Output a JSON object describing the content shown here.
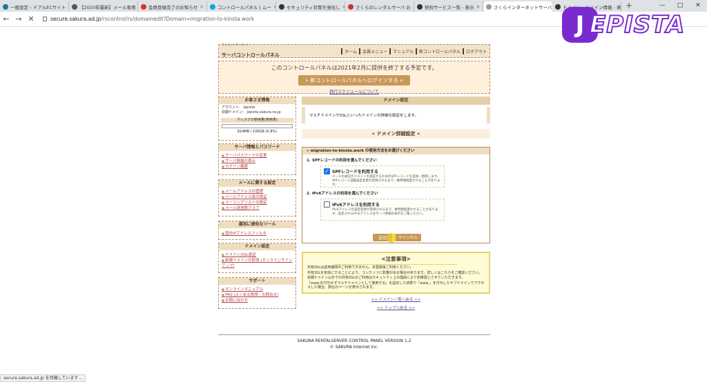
{
  "tabs": [
    "一般設定 ‹ ドアルECサイト",
    "【2020年最新】メール専用",
    "会員登録完了のお知らせ",
    "コントロールパネル | ムー",
    "セキュリティ対策を強化し",
    "さくらのレンタルサーバ お",
    "契約サービス一覧 - 表示",
    "さくらインターネットサーバコ",
    "ドメイン・ドメイン情報 - 表示"
  ],
  "window_controls": [
    "—",
    "□",
    "✕"
  ],
  "address": {
    "host": "secure.sakura.ad.jp",
    "path": "/rscontrol/rs/domainedit?Domain=migration-to-kinsta.work"
  },
  "logo": {
    "j": "J",
    "text": "EPISTA"
  },
  "header": {
    "brand_sub": "さくらインターネット",
    "brand_main": "サーバコントロールパネル",
    "nav": [
      "ホーム",
      "会員メニュー",
      "マニュアル",
      "新コントロールパネル",
      "ログアウト"
    ]
  },
  "notice": {
    "text": "このコントロールパネルは2021年2月に提供を終了する予定です。",
    "button": "» 新コントロールパネルへログインする «",
    "link": "移行スケジュールについて"
  },
  "sidebar": {
    "customer": {
      "title": "お客さま情報",
      "account": "アカウント:　jepista",
      "domain": "初期ドメイン:　jepista.sakura.ne.jp",
      "disk_title": "ディスクの使用量(使用率)",
      "disk_value": "814MB / 100GB (0.8%)"
    },
    "sections": [
      {
        "title": "サーバ情報とパスワード",
        "items": [
          "サーバパスワードの変更",
          "サーバ情報の表示",
          "ログイン履歴"
        ]
      },
      {
        "title": "メールに関する設定",
        "items": [
          "メールアドレスの管理",
          "メールアドレス毎の設定",
          "メーリングリストの設定",
          "メール送信数グラフ"
        ]
      },
      {
        "title": "運用に便利なツール",
        "items": [
          "国外IPアドレスフィルタ"
        ]
      },
      {
        "title": "ドメイン設定",
        "items": [
          "ドメイン/SSL設定",
          "新規ドメインの取得 (オンラインサインアップ)"
        ]
      },
      {
        "title": "サポート",
        "items": [
          "オンラインマニュアル",
          "FAQ (よくある質問・お問合せ)",
          "お問い合わせ"
        ]
      }
    ]
  },
  "main": {
    "title": "ドメイン設定",
    "desc": "マルチドメインやSSLといったドメインの詳細な設定をします。",
    "subtitle": "» ドメイン詳細設定 «",
    "box_title": "» migration-to-kinsta.work の使用方法をお選びください",
    "q1": "1. SPFレコードの利用を選んでください",
    "opt1_label": "SPFレコードを利用する",
    "opt1_text": "メールの送信元ドメインを認証するためのSPFレコードを追加・削除します。SPFレコード自動設定変更が反映されるまで、数時間程度かかることがあります。",
    "q2": "2. IPv6アドレスの利用を選んでください",
    "opt2_label": "IPv6アドレスを利用する",
    "opt2_text": "IPv6アドレスの設定変更が反映されるまで、数時間程度かかることがあります。設定されるIPv6アドレスはサーバ情報の表示をご覧ください。",
    "ok": "送信",
    "cancel": "キャンセル",
    "caution_title": "<注意事項>",
    "caution_lines": [
      "共有SSLは試用期間中ご利用できません。本登録後ご利用ください。",
      "共有SSLを有効にすることにより、コンテンツに影響が出る場合があります。詳しくはこちらをご確認ください。",
      "初期ドメイン以外での共有SSLのご利用はセキュリティ上の理由により非推奨とさせていただきます。",
      "「www.を付与せずマルチドメインとして使用する」を設定した状態で「www.」を付与したサブドメインでアクセスした場合、弊社のページが表示されます。"
    ],
    "back_link": ">> ドメイン一覧へ戻る <<",
    "top_link": ">> トップへ戻る <<"
  },
  "footer": {
    "line1": "SAKURA RENTALSERVER CONTROL PANEL VERSION 1.2",
    "line2": "© SAKURA Internet Inc."
  },
  "status": "secure.sakura.ad.jp を待機しています..."
}
